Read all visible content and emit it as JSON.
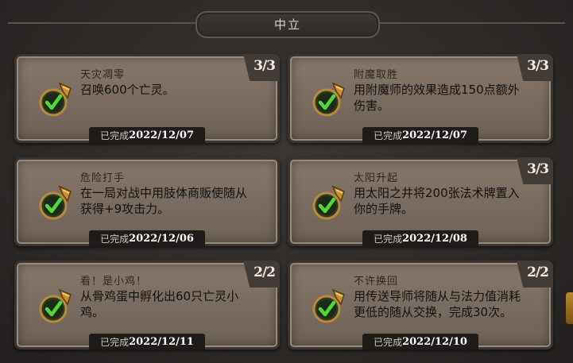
{
  "header": {
    "title": "中立"
  },
  "cards": [
    {
      "title": "天灾凋零",
      "desc": "召唤600个亡灵。",
      "progress": "3/3",
      "completed_label": "已完成",
      "date": "2022/12/07"
    },
    {
      "title": "附魔取胜",
      "desc": "用附魔师的效果造成150点额外伤害。",
      "progress": "3/3",
      "completed_label": "已完成",
      "date": "2022/12/07"
    },
    {
      "title": "危险打手",
      "desc": "在一局对战中用肢体商贩使随从获得+9攻击力。",
      "progress": "",
      "completed_label": "已完成",
      "date": "2022/12/06"
    },
    {
      "title": "太阳升起",
      "desc": "用太阳之井将200张法术牌置入你的手牌。",
      "progress": "3/3",
      "completed_label": "已完成",
      "date": "2022/12/08"
    },
    {
      "title": "看！是小鸡！",
      "desc": "从骨鸡蛋中孵化出60只亡灵小鸡。",
      "progress": "2/2",
      "completed_label": "已完成",
      "date": "2022/12/11"
    },
    {
      "title": "不许换回",
      "desc": "用传送导师将随从与法力值消耗更低的随从交换，完成30次。",
      "progress": "2/2",
      "completed_label": "已完成",
      "date": "2022/12/10"
    }
  ],
  "icon": "scroll-checkmark-icon",
  "colors": {
    "card_bg": "#7f7063",
    "check_green": "#3fbf2a",
    "scroll_gold": "#c8902e"
  }
}
